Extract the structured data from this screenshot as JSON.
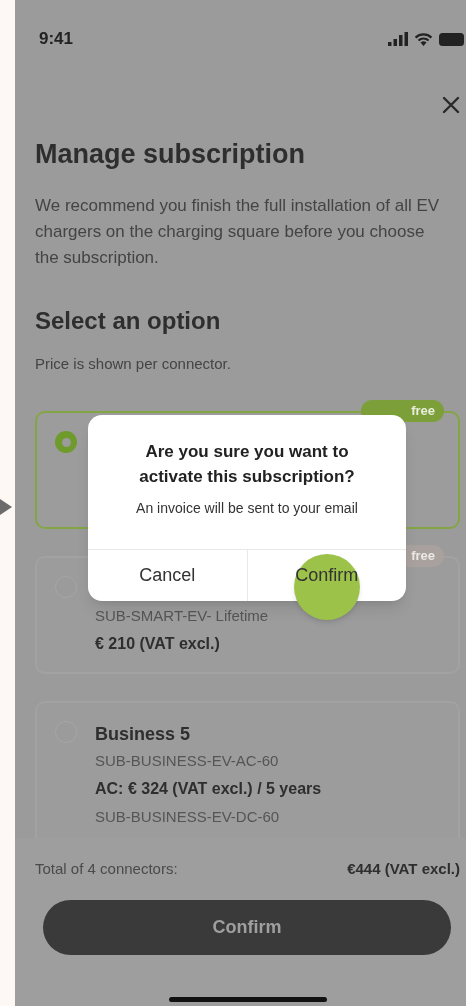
{
  "status_bar": {
    "time": "9:41"
  },
  "header": {
    "title": "Manage subscription",
    "description": "We recommend you finish the full installation of all EV chargers on the charging square before you choose the subscription."
  },
  "section": {
    "title": "Select an option",
    "note": "Price is shown per connector."
  },
  "options": [
    {
      "selected": true,
      "badge": "free"
    },
    {
      "selected": false,
      "badge": "free",
      "lines": [
        {
          "text": "SUB-SMART-EV- Lifetime",
          "kind": "code"
        },
        {
          "text": "€ 210 (VAT excl.)",
          "kind": "price"
        }
      ]
    },
    {
      "selected": false,
      "title": "Business 5",
      "lines": [
        {
          "text": "SUB-BUSINESS-EV-AC-60",
          "kind": "code"
        },
        {
          "text": "AC: € 324 (VAT excl.) / 5 years",
          "kind": "price"
        },
        {
          "text": "SUB-BUSINESS-EV-DC-60",
          "kind": "code"
        }
      ]
    }
  ],
  "footer": {
    "total_label": "Total of 4 connectors:",
    "total_value": "€444 (VAT excl.)",
    "button": "Confirm"
  },
  "dialog": {
    "title": "Are you sure you want to activate this subscription?",
    "message": "An invoice will be sent to your email",
    "buttons": [
      {
        "label": "Cancel",
        "pressed": false
      },
      {
        "label": "Confirm",
        "pressed": true
      }
    ]
  }
}
